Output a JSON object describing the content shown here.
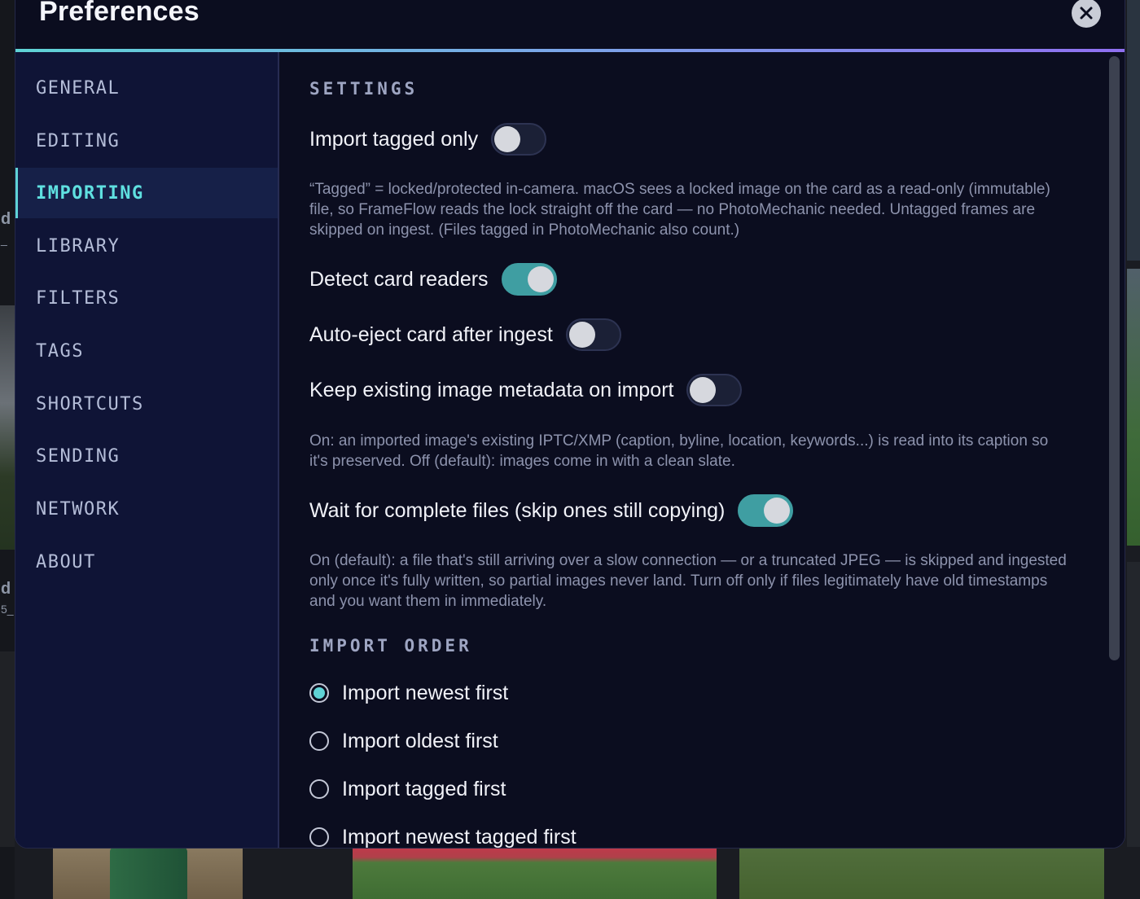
{
  "window": {
    "title": "Preferences",
    "close_icon": "close-icon"
  },
  "background": {
    "side_text_1": "d",
    "side_text_2": "d",
    "side_small_1": "_",
    "side_small_2": "5_"
  },
  "sidebar": {
    "items": [
      {
        "label": "GENERAL"
      },
      {
        "label": "EDITING"
      },
      {
        "label": "IMPORTING",
        "active": true
      },
      {
        "label": "LIBRARY"
      },
      {
        "label": "FILTERS"
      },
      {
        "label": "TAGS"
      },
      {
        "label": "SHORTCUTS"
      },
      {
        "label": "SENDING"
      },
      {
        "label": "NETWORK"
      },
      {
        "label": "ABOUT"
      }
    ]
  },
  "content": {
    "settings_heading": "SETTINGS",
    "settings": [
      {
        "label": "Import tagged only",
        "on": false,
        "help": "“Tagged” = locked/protected in-camera. macOS sees a locked image on the card as a read-only (immutable) file, so FrameFlow reads the lock straight off the card — no PhotoMechanic needed. Untagged frames are skipped on ingest. (Files tagged in PhotoMechanic also count.)"
      },
      {
        "label": "Detect card readers",
        "on": true,
        "help": ""
      },
      {
        "label": "Auto-eject card after ingest",
        "on": false,
        "help": ""
      },
      {
        "label": "Keep existing image metadata on import",
        "on": false,
        "help": "On: an imported image's existing IPTC/XMP (caption, byline, location, keywords...) is read into its caption so it's preserved. Off (default): images come in with a clean slate."
      },
      {
        "label": "Wait for complete files (skip ones still copying)",
        "on": true,
        "help": "On (default): a file that's still arriving over a slow connection — or a truncated JPEG — is skipped and ingested only once it's fully written, so partial images never land. Turn off only if files legitimately have old timestamps and you want them in immediately."
      }
    ],
    "import_order_heading": "IMPORT ORDER",
    "import_order": [
      {
        "label": "Import newest first",
        "checked": true
      },
      {
        "label": "Import oldest first",
        "checked": false
      },
      {
        "label": "Import tagged first",
        "checked": false
      },
      {
        "label": "Import newest tagged first",
        "checked": false
      }
    ]
  },
  "colors": {
    "accent": "#5fd3d6",
    "toggle_on": "#3f9ea2",
    "modal_bg": "#0b0d1f",
    "sidebar_bg": "#0f1436"
  }
}
